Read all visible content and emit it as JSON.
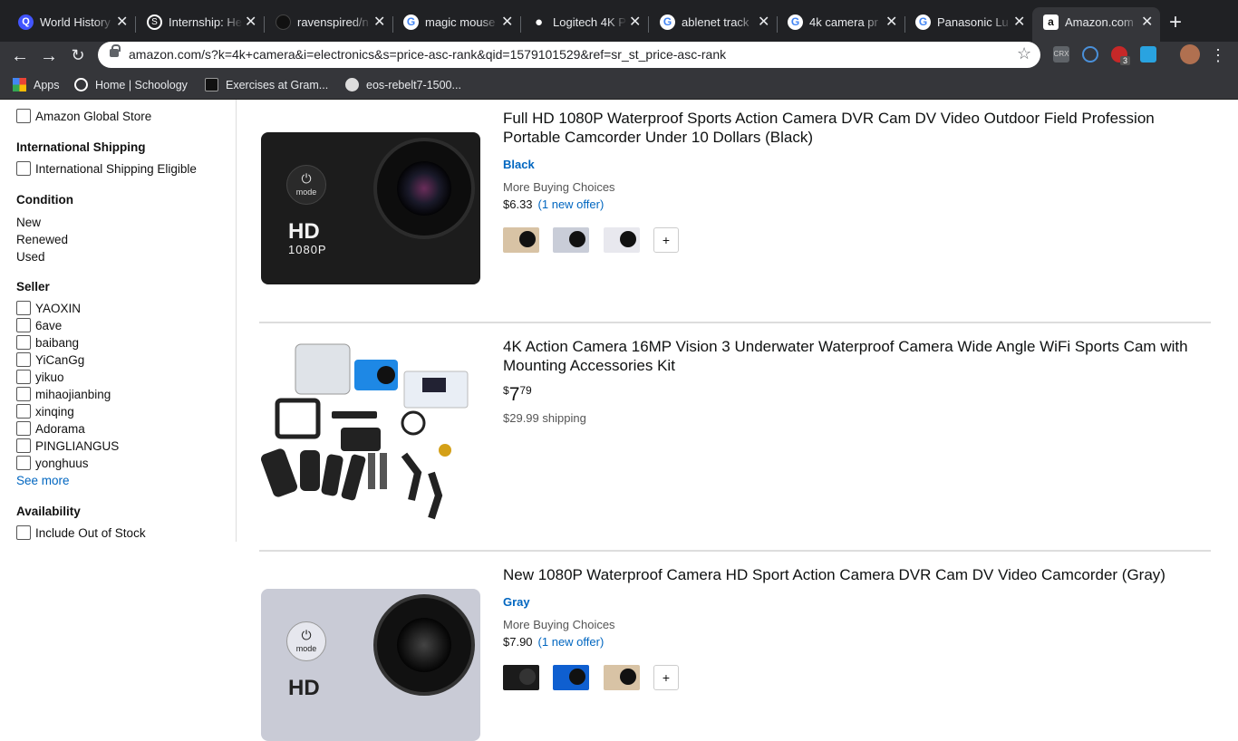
{
  "browser": {
    "tabs": [
      {
        "title": "World History",
        "icon": "quizlet-icon",
        "color": "#4255ff"
      },
      {
        "title": "Internship: He",
        "icon": "schoology-icon",
        "color": "#1a9bd7"
      },
      {
        "title": "ravenspired/n",
        "icon": "github-icon",
        "color": "#24292e"
      },
      {
        "title": "magic mouse",
        "icon": "google-icon",
        "color": "#4285f4"
      },
      {
        "title": "Logitech 4K P",
        "icon": "apple-icon",
        "color": "#ffffff"
      },
      {
        "title": "ablenet track",
        "icon": "google-icon",
        "color": "#4285f4"
      },
      {
        "title": "4k camera pr",
        "icon": "google-icon",
        "color": "#4285f4"
      },
      {
        "title": "Panasonic Lu",
        "icon": "google-icon",
        "color": "#4285f4"
      },
      {
        "title": "Amazon.com",
        "icon": "amazon-icon",
        "color": "#ffffff"
      }
    ],
    "url": "amazon.com/s?k=4k+camera&i=electronics&s=price-asc-rank&qid=1579101529&ref=sr_st_price-asc-rank",
    "bookmarks": [
      "Apps",
      "Home | Schoology",
      "Exercises at Gram...",
      "eos-rebelt7-1500..."
    ],
    "ext_badge": "3"
  },
  "sidebar": {
    "global_store": "Amazon Global Store",
    "intl_heading": "International Shipping",
    "intl_option": "International Shipping Eligible",
    "condition_heading": "Condition",
    "conditions": [
      "New",
      "Renewed",
      "Used"
    ],
    "seller_heading": "Seller",
    "sellers": [
      "YAOXIN",
      "6ave",
      "baibang",
      "YiCanGg",
      "yikuo",
      "mihaojianbing",
      "xinqing",
      "Adorama",
      "PINGLIANGUS",
      "yonghuus"
    ],
    "see_more": "See more",
    "availability_heading": "Availability",
    "availability_option": "Include Out of Stock"
  },
  "results": [
    {
      "title": "Full HD 1080P Waterproof Sports Action Camera DVR Cam DV Video Outdoor Field Profession Portable Camcorder Under 10 Dollars (Black)",
      "variant": "Black",
      "more_buying": "More Buying Choices",
      "price": "$6.33",
      "offer": "(1 new offer)",
      "swatch_colors": [
        "#d8c3a5",
        "#c9cdd8",
        "#e8e8ee"
      ],
      "plus": "+",
      "image_label_hd": "HD",
      "image_label_res": "1080P",
      "image_label_mode": "mode",
      "body_color": "#1e1e1e"
    },
    {
      "title": "4K Action Camera 16MP Vision 3 Underwater Waterproof Camera Wide Angle WiFi Sports Cam with Mounting Accessories Kit",
      "price_symbol": "$",
      "price_whole": "7",
      "price_fraction": "79",
      "shipping": "$29.99 shipping"
    },
    {
      "title": "New 1080P Waterproof Camera HD Sport Action Camera DVR Cam DV Video Camcorder (Gray)",
      "variant": "Gray",
      "more_buying": "More Buying Choices",
      "price": "$7.90",
      "offer": "(1 new offer)",
      "swatch_colors": [
        "#1b1b1b",
        "#0f5fd0",
        "#d8c3a5"
      ],
      "plus": "+",
      "image_label_hd": "HD",
      "image_label_mode": "mode",
      "body_color": "#c9cbd6"
    }
  ]
}
